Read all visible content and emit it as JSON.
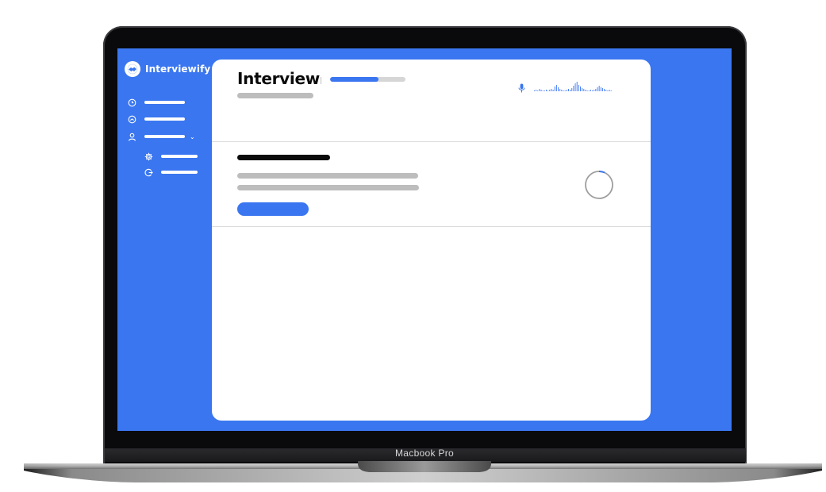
{
  "app": {
    "name": "Interviewify",
    "brand_color": "#3a76f0"
  },
  "sidebar": {
    "items": [
      {
        "icon": "clock-icon",
        "label": ""
      },
      {
        "icon": "gauge-icon",
        "label": ""
      },
      {
        "icon": "user-icon",
        "label": "",
        "expandable": true
      },
      {
        "icon": "gear-icon",
        "label": "",
        "sub": true
      },
      {
        "icon": "logout-icon",
        "label": "",
        "sub": true
      }
    ]
  },
  "main": {
    "title": "Interview",
    "progress": 0.64,
    "microphone_icon": "microphone-icon"
  },
  "device": {
    "model_label": "Macbook Pro"
  }
}
